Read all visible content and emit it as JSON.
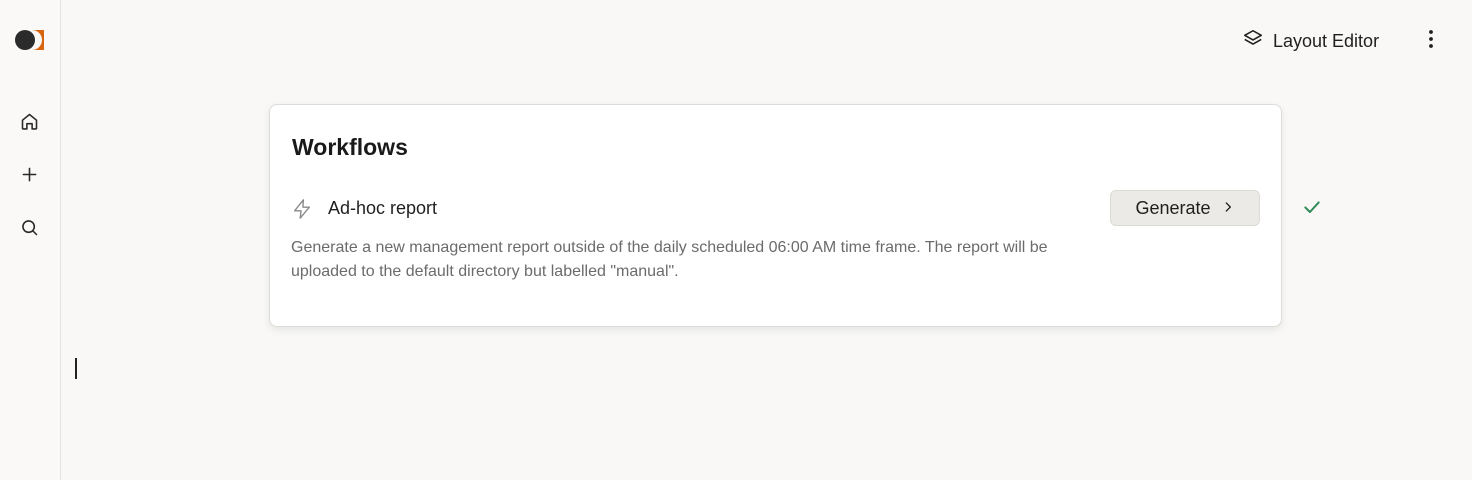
{
  "sidebar": {
    "logo_icon": "app-logo-icon",
    "items": [
      {
        "icon": "home-icon",
        "label": "Home"
      },
      {
        "icon": "plus-icon",
        "label": "New"
      },
      {
        "icon": "search-icon",
        "label": "Search"
      }
    ]
  },
  "header": {
    "layout_editor_label": "Layout Editor",
    "layout_editor_icon": "layers-icon",
    "menu_icon": "more-vertical-icon"
  },
  "workflows": {
    "title": "Workflows",
    "item": {
      "icon": "lightning-icon",
      "title": "Ad-hoc report",
      "description": "Generate a new management report outside of the daily scheduled 06:00 AM time frame. The report will be uploaded to the default directory but labelled \"manual\".",
      "button_label": "Generate",
      "button_icon": "chevron-right-icon",
      "status_icon": "checkmark-icon"
    }
  },
  "colors": {
    "logo_dark": "#2b2b2b",
    "logo_accent": "#d9640f",
    "success": "#2e8b57",
    "background": "#f9f8f6"
  }
}
